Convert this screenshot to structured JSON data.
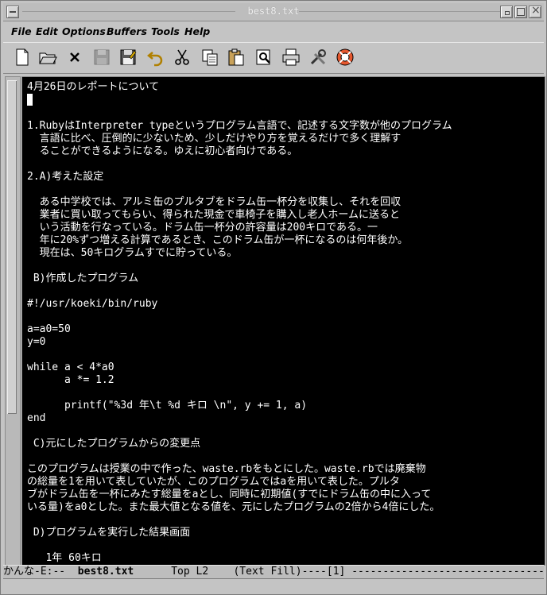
{
  "window": {
    "title": "best8.txt"
  },
  "menu": [
    "File",
    "Edit",
    "Options",
    "Buffers",
    "Tools",
    "Help"
  ],
  "toolbar_icons": [
    "new-file-icon",
    "open-folder-icon",
    "close-icon",
    "save-icon",
    "save-as-icon",
    "undo-icon",
    "cut-icon",
    "copy-icon",
    "paste-icon",
    "search-icon",
    "print-icon",
    "tools-icon",
    "help-icon"
  ],
  "buffer": {
    "lines": [
      "4月26日のレポートについて",
      "",
      "",
      "1.RubyはInterpreter typeというプログラム言語で、記述する文字数が他のプログラム",
      "  言語に比べ、圧倒的に少ないため、少しだけやり方を覚えるだけで多く理解す",
      "  ることができるようになる。ゆえに初心者向けである。",
      "",
      "2.A)考えた設定",
      "",
      "  ある中学校では、アルミ缶のプルタブをドラム缶一杯分を収集し、それを回収",
      "  業者に買い取ってもらい、得られた現金で車椅子を購入し老人ホームに送ると",
      "  いう活動を行なっている。ドラム缶一杯分の許容量は200キロである。一",
      "  年に20%ずつ増える計算であるとき、このドラム缶が一杯になるのは何年後か。",
      "  現在は、50キログラムすでに貯っている。",
      "",
      " B)作成したプログラム",
      "",
      "#!/usr/koeki/bin/ruby",
      "",
      "a=a0=50",
      "y=0",
      "",
      "while a < 4*a0",
      "      a *= 1.2",
      "",
      "      printf(\"%3d 年\\t %d キロ \\n\", y += 1, a)",
      "end",
      "",
      " C)元にしたプログラムからの変更点",
      "",
      "このプログラムは授業の中で作った、waste.rbをもとにした。waste.rbでは廃棄物",
      "の総量を1を用いて表していたが、このプログラムではaを用いて表した。プルタ",
      "ブがドラム缶を一杯にみたす総量をaとし、同時に初期値(すでにドラム缶の中に入って",
      "いる量)をa0とした。また最大値となる値を、元にしたプログラムの2倍から4倍にした。",
      "",
      " D)プログラムを実行した結果画面",
      "",
      "   1年 60キロ"
    ]
  },
  "modeline": {
    "prefix": "かんな-E:--  ",
    "buffer_name": "best8.txt",
    "position": "      Top L2    ",
    "mode": "(Text Fill)----",
    "tail": "[1] -------------------------------"
  }
}
